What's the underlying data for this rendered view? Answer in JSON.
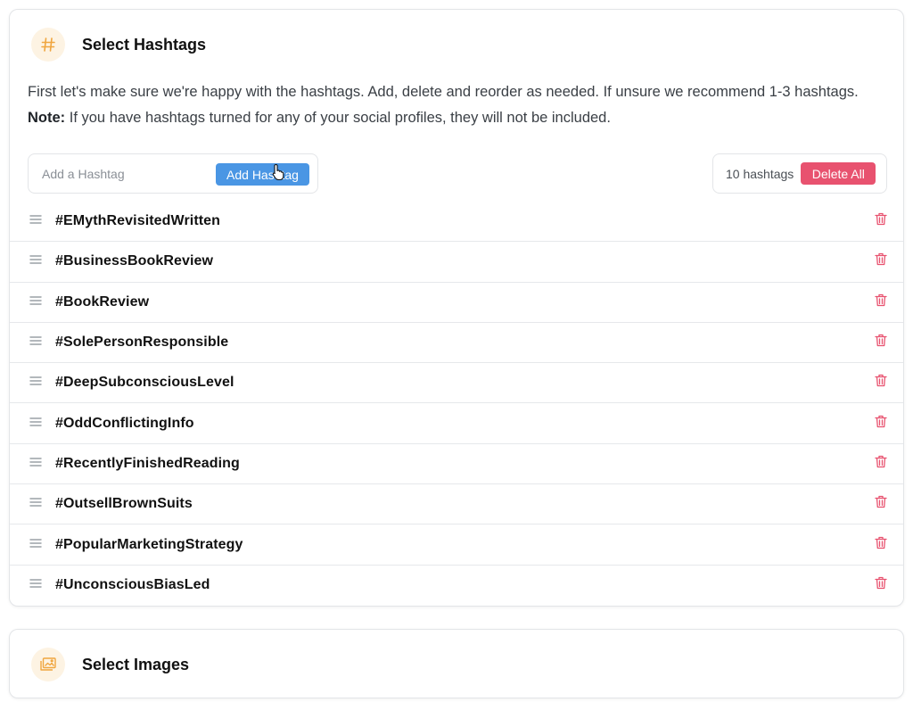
{
  "hashtags_section": {
    "title": "Select Hashtags",
    "icon": "hash-icon",
    "description_main": "First let's make sure we're happy with the hashtags. Add, delete and reorder as needed. If unsure we recommend 1-3 hashtags. ",
    "note_label": "Note:",
    "description_note": " If you have hashtags turned for any of your social profiles, they will not be included.",
    "add_input_placeholder": "Add a Hashtag",
    "add_button_label": "Add Hashtag",
    "count_label": "10 hashtags",
    "delete_all_label": "Delete All",
    "hashtags": [
      "#EMythRevisitedWritten",
      "#BusinessBookReview",
      "#BookReview",
      "#SolePersonResponsible",
      "#DeepSubconsciousLevel",
      "#OddConflictingInfo",
      "#RecentlyFinishedReading",
      "#OutsellBrownSuits",
      "#PopularMarketingStrategy",
      "#UnconsciousBiasLed"
    ]
  },
  "images_section": {
    "title": "Select Images",
    "icon": "images-icon"
  },
  "colors": {
    "accent_blue": "#4a96e4",
    "danger_pink": "#e8526f",
    "icon_orange": "#f0a640",
    "icon_bg": "#fdf3e3"
  }
}
